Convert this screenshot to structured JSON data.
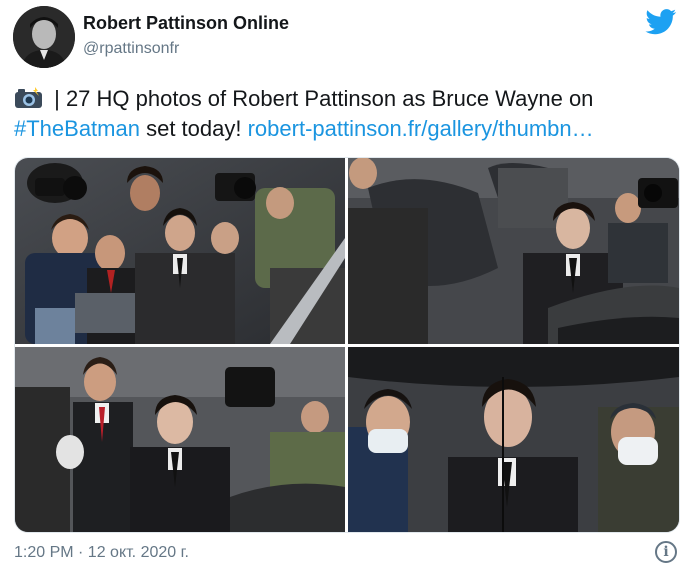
{
  "tweet": {
    "author_name": "Robert Pattinson Online",
    "author_handle": "@rpattinsonfr",
    "text_separator": " | 27 HQ photos of Robert Pattinson as Bruce Wayne on ",
    "hashtag": "#TheBatman",
    "text_middle": " set today! ",
    "link": "robert-pattinson.fr/gallery/thumbn…",
    "timestamp": "1:20 PM · 12 окт. 2020 г.",
    "icons": {
      "camera": "camera-flash-icon",
      "bird": "twitter-bird-icon",
      "info": "info-icon"
    },
    "info_glyph": "i"
  },
  "media": {
    "photo_count_shown": 4,
    "photos": [
      {
        "name": "photo-1"
      },
      {
        "name": "photo-2"
      },
      {
        "name": "photo-3"
      },
      {
        "name": "photo-4"
      }
    ]
  },
  "colors": {
    "link": "#1b95e0",
    "twitter_blue": "#1da1f2",
    "secondary_text": "#657786"
  }
}
